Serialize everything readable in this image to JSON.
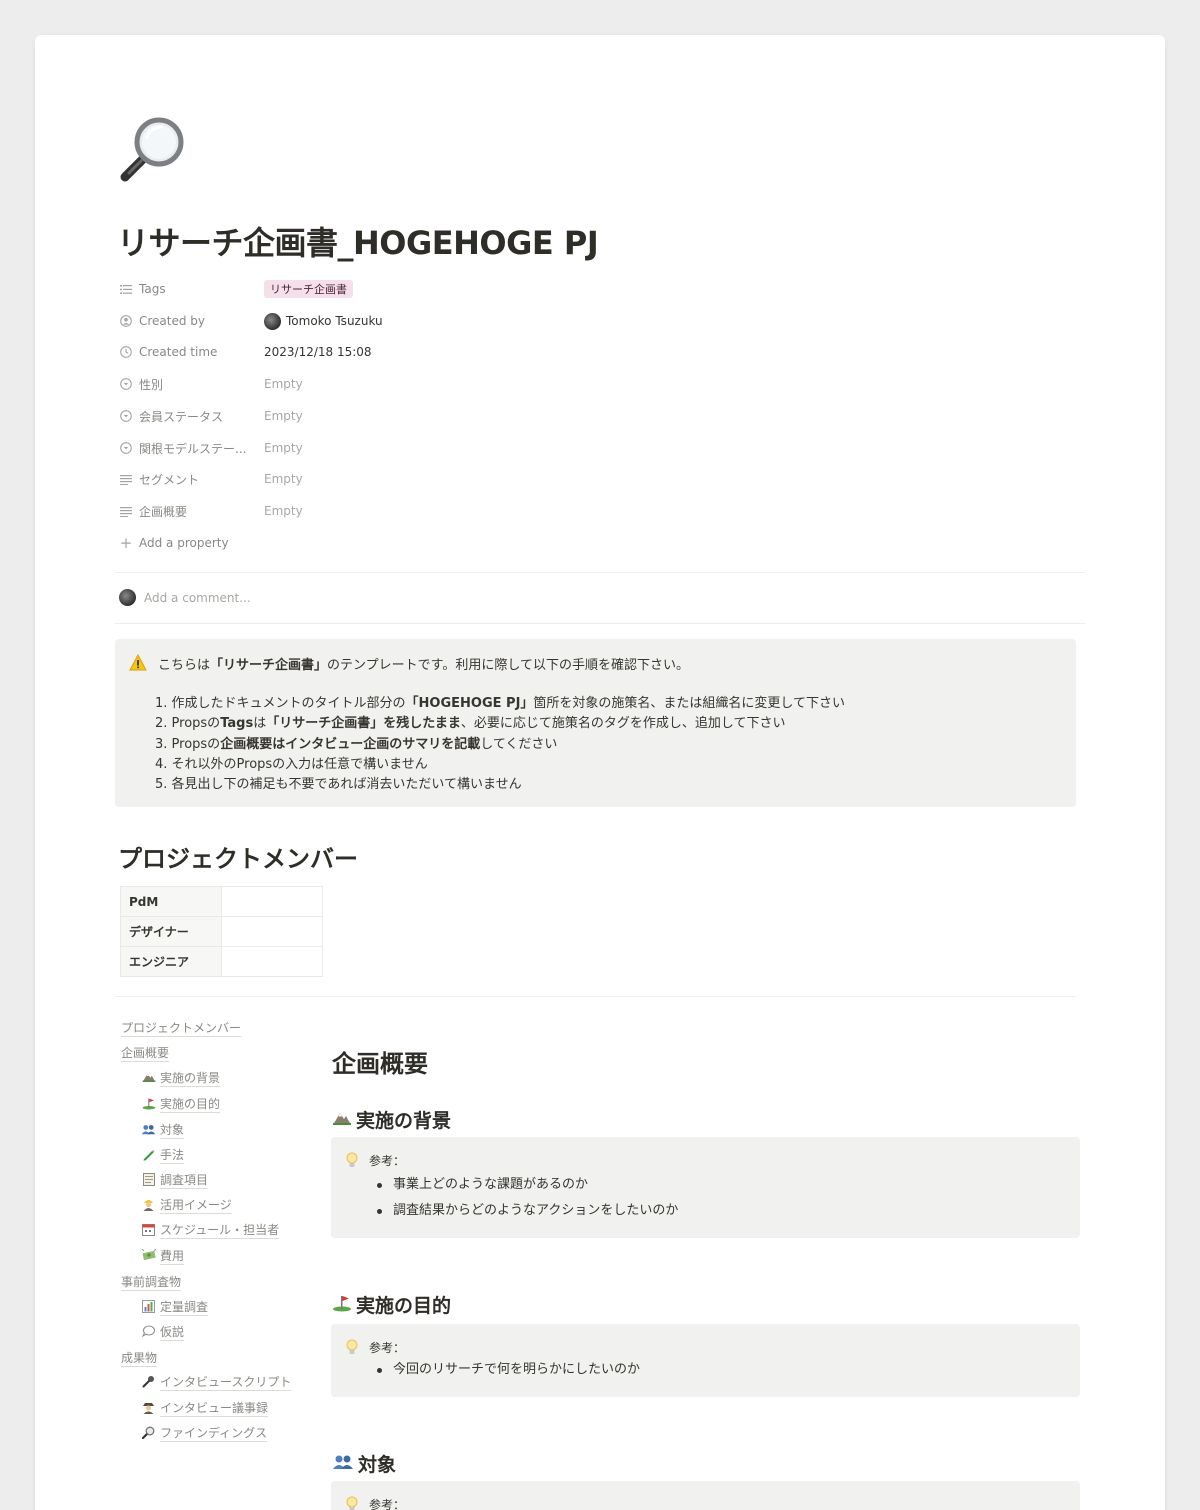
{
  "page": {
    "icon": "magnifying-glass-icon",
    "title": "リサーチ企画書_HOGEHOGE PJ"
  },
  "properties": [
    {
      "icon": "list-icon",
      "key": "Tags",
      "value": "リサーチ企画書",
      "type": "tag"
    },
    {
      "icon": "person-icon",
      "key": "Created by",
      "value": "Tomoko Tsuzuku",
      "type": "person"
    },
    {
      "icon": "clock-icon",
      "key": "Created time",
      "value": "2023/12/18 15:08",
      "type": "text"
    },
    {
      "icon": "select-icon",
      "key": "性別",
      "value": "Empty",
      "type": "empty"
    },
    {
      "icon": "select-icon",
      "key": "会員ステータス",
      "value": "Empty",
      "type": "empty"
    },
    {
      "icon": "select-icon",
      "key": "関根モデルステー...",
      "value": "Empty",
      "type": "empty"
    },
    {
      "icon": "text-icon",
      "key": "セグメント",
      "value": "Empty",
      "type": "empty"
    },
    {
      "icon": "text-icon",
      "key": "企画概要",
      "value": "Empty",
      "type": "empty"
    }
  ],
  "add_property": "Add a property",
  "comment_placeholder": "Add a comment...",
  "intro_callout": {
    "icon": "warning-icon",
    "head_pre": "こちらは",
    "head_bold": "「リサーチ企画書」",
    "head_post": "のテンプレートです。利用に際して以下の手順を確認下さい。",
    "steps": [
      {
        "pre": "1. 作成したドキュメントのタイトル部分の",
        "bold": "「HOGEHOGE PJ」",
        "mid": "箇所を対象の施策名、または組織名に変更して下さい",
        "bold2": "",
        "post": ""
      },
      {
        "pre": "2. Propsの",
        "bold": "Tags",
        "mid": "は",
        "bold2": "「リサーチ企画書」を残したまま",
        "post": "、必要に応じて施策名のタグを作成し、追加して下さい"
      },
      {
        "pre": "3. Propsの",
        "bold": "企画概要はインタビュー企画のサマリを記載",
        "mid": "してください",
        "bold2": "",
        "post": ""
      },
      {
        "pre": "4. それ以外のPropsの入力は任意で構いません",
        "bold": "",
        "mid": "",
        "bold2": "",
        "post": ""
      },
      {
        "pre": "5. 各見出し下の補足も不要であれば消去いただいて構いません",
        "bold": "",
        "mid": "",
        "bold2": "",
        "post": ""
      }
    ]
  },
  "members": {
    "heading": "プロジェクトメンバー",
    "rows": [
      {
        "role": "PdM",
        "name": ""
      },
      {
        "role": "デザイナー",
        "name": ""
      },
      {
        "role": "エンジニア",
        "name": ""
      }
    ]
  },
  "toc": [
    {
      "label": "プロジェクトメンバー",
      "level": 0,
      "icon": ""
    },
    {
      "label": "企画概要",
      "level": 0,
      "icon": ""
    },
    {
      "label": "実施の背景",
      "level": 1,
      "icon": "mountain-icon"
    },
    {
      "label": "実施の目的",
      "level": 1,
      "icon": "golf-flag-icon"
    },
    {
      "label": "対象",
      "level": 1,
      "icon": "people-icon"
    },
    {
      "label": "手法",
      "level": 1,
      "icon": "pen-icon"
    },
    {
      "label": "調査項目",
      "level": 1,
      "icon": "notepad-icon"
    },
    {
      "label": "活用イメージ",
      "level": 1,
      "icon": "worker-icon"
    },
    {
      "label": "スケジュール・担当者",
      "level": 1,
      "icon": "calendar-icon"
    },
    {
      "label": "費用",
      "level": 1,
      "icon": "money-icon"
    },
    {
      "label": "事前調査物",
      "level": 0,
      "icon": ""
    },
    {
      "label": "定量調査",
      "level": 1,
      "icon": "bar-chart-icon"
    },
    {
      "label": "仮説",
      "level": 1,
      "icon": "speech-bubble-icon"
    },
    {
      "label": "成果物",
      "level": 0,
      "icon": ""
    },
    {
      "label": "インタビュースクリプト",
      "level": 1,
      "icon": "microphone-icon"
    },
    {
      "label": "インタビュー議事録",
      "level": 1,
      "icon": "detective-icon"
    },
    {
      "label": "ファインディングス",
      "level": 1,
      "icon": "magnifying-glass-icon"
    }
  ],
  "overview": {
    "heading": "企画概要",
    "sections": [
      {
        "icon": "mountain-icon",
        "title": "実施の背景",
        "ref": "参考：",
        "bullets": [
          "事業上どのような課題があるのか",
          "調査結果からどのようなアクションをしたいのか"
        ]
      },
      {
        "icon": "golf-flag-icon",
        "title": "実施の目的",
        "ref": "参考：",
        "bullets": [
          "今回のリサーチで何を明らかにしたいのか"
        ]
      },
      {
        "icon": "people-icon",
        "title": "対象",
        "ref": "参考：",
        "bullets": []
      }
    ]
  }
}
